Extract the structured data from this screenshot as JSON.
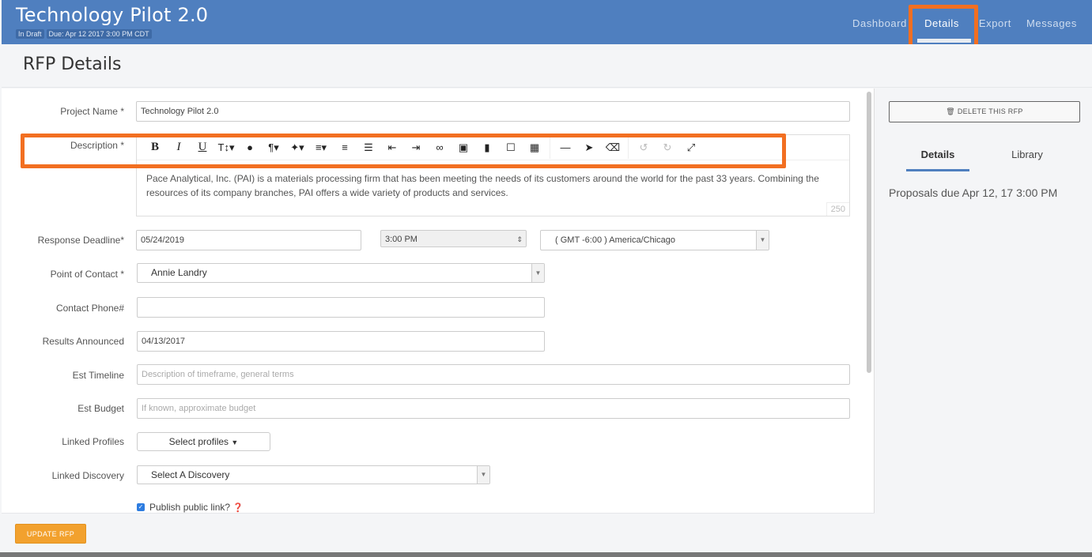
{
  "header": {
    "title": "Technology Pilot 2.0",
    "badges": [
      "In Draft",
      "Due: Apr 12 2017 3:00 PM CDT"
    ],
    "nav": [
      "Dashboard",
      "Details",
      "Export",
      "Messages"
    ]
  },
  "page": {
    "title": "RFP Details"
  },
  "form": {
    "project_name_label": "Project Name",
    "project_name_value": "Technology Pilot 2.0",
    "description_label": "Description",
    "description_text": "Pace Analytical, Inc. (PAI) is a materials processing firm that has been meeting the needs of its customers around the world for the past 33 years. Combining the resources of its company branches, PAI offers a wide variety of products and services.",
    "description_counter": "250",
    "response_deadline_label": "Response Deadline",
    "response_deadline_date": "05/24/2019",
    "response_deadline_time": "3:00 PM",
    "response_deadline_tz": "( GMT -6:00 ) America/Chicago",
    "point_of_contact_label": "Point of Contact",
    "point_of_contact_value": "Annie Landry",
    "contact_phone_label": "Contact Phone#",
    "contact_phone_value": "",
    "results_announced_label": "Results Announced",
    "results_announced_value": "04/13/2017",
    "est_timeline_label": "Est Timeline",
    "est_timeline_placeholder": "Description of timeframe, general terms",
    "est_budget_label": "Est Budget",
    "est_budget_placeholder": "If known, approximate budget",
    "linked_profiles_label": "Linked Profiles",
    "linked_profiles_button": "Select profiles",
    "linked_discovery_label": "Linked Discovery",
    "linked_discovery_value": "Select A Discovery",
    "publish_label": "Publish public link?",
    "required_mark": "*"
  },
  "toolbar_icons": [
    "bold-icon",
    "italic-icon",
    "underline-icon",
    "font-size-icon",
    "color-icon",
    "paragraph-icon",
    "magic-icon",
    "align-icon",
    "ordered-list-icon",
    "unordered-list-icon",
    "outdent-icon",
    "indent-icon",
    "link-icon",
    "image-icon",
    "video-icon",
    "file-icon",
    "table-icon",
    "hr-icon",
    "cursor-icon",
    "eraser-icon",
    "undo-icon",
    "redo-icon",
    "fullscreen-icon"
  ],
  "footer": {
    "update_button": "UPDATE RFP"
  },
  "sidebar": {
    "delete_button": "DELETE THIS RFP",
    "tabs": [
      "Details",
      "Library"
    ],
    "info": "Proposals due Apr 12, 17 3:00 PM"
  },
  "colors": {
    "header": "#4f7fbf",
    "highlight": "#f26f21",
    "update_button": "#f2a12e"
  }
}
